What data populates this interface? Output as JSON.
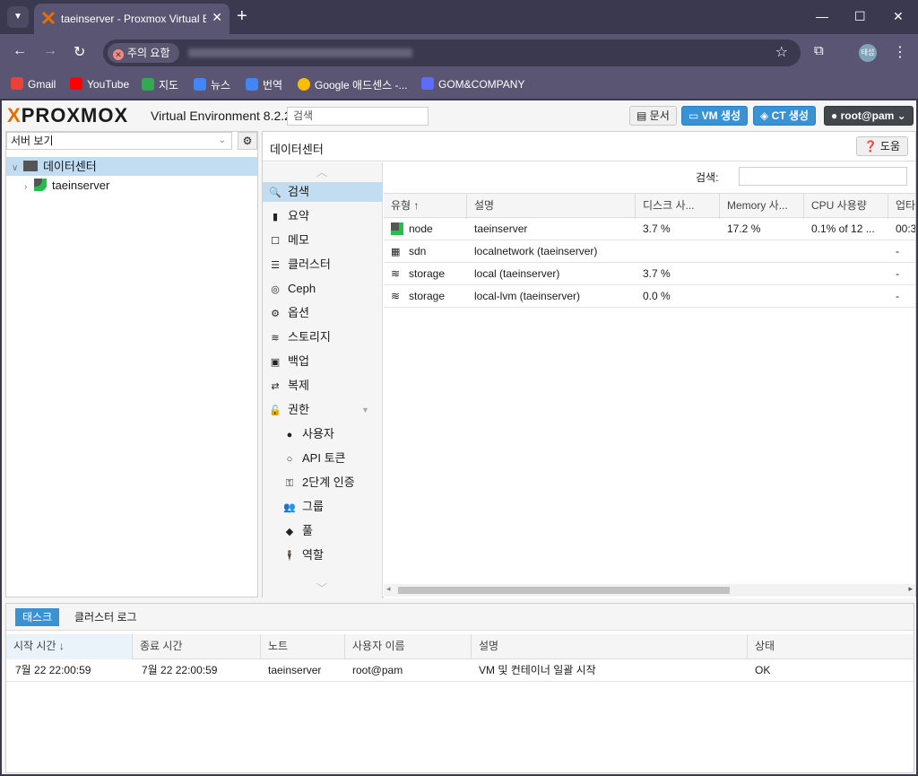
{
  "browser": {
    "tab_title": "taeinserver - Proxmox Virtual E",
    "security_chip": "주의 요함",
    "avatar_label": "태섭",
    "bookmarks": [
      {
        "label": "Gmail",
        "color": "#ea4335"
      },
      {
        "label": "YouTube",
        "color": "#ff0000"
      },
      {
        "label": "지도",
        "color": "#34a853"
      },
      {
        "label": "뉴스",
        "color": "#4285f4"
      },
      {
        "label": "번역",
        "color": "#4285f4"
      },
      {
        "label": "Google 애드센스 -...",
        "color": "#fbbc04"
      },
      {
        "label": "GOM&COMPANY",
        "color": "#5b6cff"
      }
    ]
  },
  "header": {
    "logo": "PROXMOX",
    "version": "Virtual Environment 8.2.2",
    "search_placeholder": "검색",
    "docs_label": "문서",
    "create_vm_label": "VM 생성",
    "create_ct_label": "CT 생성",
    "user_label": "root@pam"
  },
  "tree": {
    "view_label": "서버 보기",
    "items": [
      {
        "label": "데이터센터"
      },
      {
        "label": "taeinserver"
      }
    ]
  },
  "content": {
    "title": "데이터센터",
    "help_label": "도움",
    "menu": [
      {
        "label": "검색",
        "icon": "search-icon"
      },
      {
        "label": "요약",
        "icon": "book-icon"
      },
      {
        "label": "메모",
        "icon": "note-icon"
      },
      {
        "label": "클러스터",
        "icon": "server-icon"
      },
      {
        "label": "Ceph",
        "icon": "ceph-icon"
      },
      {
        "label": "옵션",
        "icon": "gear-icon"
      },
      {
        "label": "스토리지",
        "icon": "database-icon"
      },
      {
        "label": "백업",
        "icon": "floppy-icon"
      },
      {
        "label": "복제",
        "icon": "retweet-icon"
      },
      {
        "label": "권한",
        "icon": "unlock-icon"
      },
      {
        "label": "사용자",
        "icon": "user-icon"
      },
      {
        "label": "API 토큰",
        "icon": "user-outline-icon"
      },
      {
        "label": "2단계 인증",
        "icon": "key-icon"
      },
      {
        "label": "그룹",
        "icon": "users-icon"
      },
      {
        "label": "풀",
        "icon": "tags-icon"
      },
      {
        "label": "역할",
        "icon": "male-icon"
      }
    ],
    "grid": {
      "search_label": "검색:",
      "columns": [
        "유형 ↑",
        "설명",
        "디스크 사...",
        "Memory 사...",
        "CPU 사용량",
        "업타"
      ],
      "rows": [
        {
          "type": "node",
          "desc": "taeinserver",
          "disk": "3.7 %",
          "mem": "17.2 %",
          "cpu": "0.1% of 12 ...",
          "uptime": "00:3"
        },
        {
          "type": "sdn",
          "desc": "localnetwork (taeinserver)",
          "disk": "",
          "mem": "",
          "cpu": "",
          "uptime": "-"
        },
        {
          "type": "storage",
          "desc": "local (taeinserver)",
          "disk": "3.7 %",
          "mem": "",
          "cpu": "",
          "uptime": "-"
        },
        {
          "type": "storage",
          "desc": "local-lvm (taeinserver)",
          "disk": "0.0 %",
          "mem": "",
          "cpu": "",
          "uptime": "-"
        }
      ]
    }
  },
  "log": {
    "tabs": [
      "태스크",
      "클러스터 로그"
    ],
    "columns": [
      "시작 시간 ↓",
      "종료 시간",
      "노트",
      "사용자 이름",
      "설명",
      "상태"
    ],
    "rows": [
      {
        "start": "7월 22 22:00:59",
        "end": "7월 22 22:00:59",
        "node": "taeinserver",
        "user": "root@pam",
        "desc": "VM 및 컨테이너 일괄 시작",
        "status": "OK"
      }
    ]
  }
}
